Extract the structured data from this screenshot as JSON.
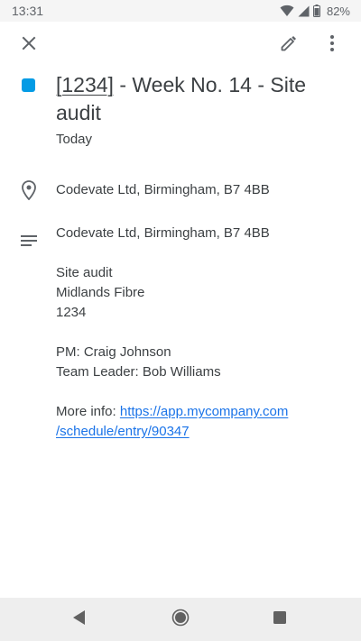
{
  "status_bar": {
    "time": "13:31",
    "battery": "82%",
    "icons": [
      "wifi-icon",
      "signal-icon",
      "battery-icon"
    ]
  },
  "toolbar": {
    "close_icon": "close-icon",
    "edit_icon": "pencil-icon",
    "more_icon": "more-vert-icon"
  },
  "event": {
    "color": "#039be5",
    "title_ref": "[1234]",
    "title_rest": " - Week No. 14 - Site audit",
    "date": "Today",
    "location": "Codevate Ltd, Birmingham, B7 4BB",
    "description": {
      "address": "Codevate Ltd, Birmingham, B7 4BB",
      "lines1": [
        "Site audit",
        "Midlands Fibre",
        "1234"
      ],
      "lines2": [
        "PM: Craig Johnson",
        "Team Leader: Bob Williams"
      ],
      "more_info_label": "More info: ",
      "link_part1": "https://app.mycompany.com",
      "link_part2": "/schedule/entry/90347"
    }
  },
  "colors": {
    "accent": "#039be5",
    "link": "#1a73e8"
  },
  "nav_bar": {
    "icons": [
      "back-icon",
      "home-icon",
      "recents-icon"
    ]
  }
}
